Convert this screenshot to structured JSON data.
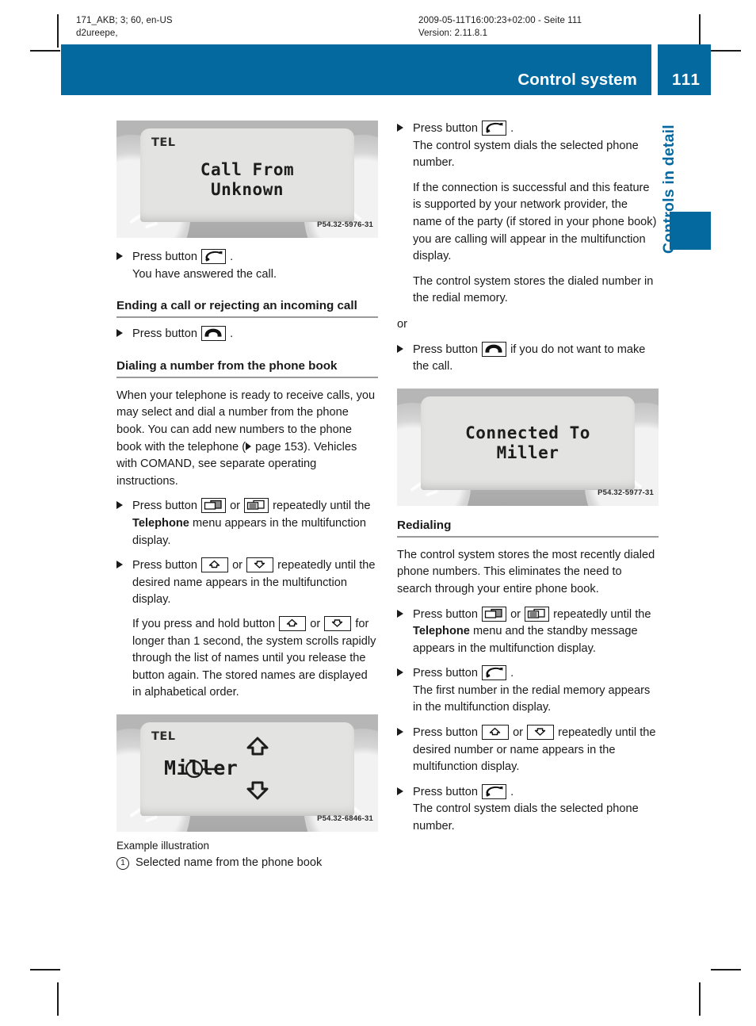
{
  "meta": {
    "left_line1": "171_AKB; 3; 60, en-US",
    "left_line2": "d2ureepe,",
    "right_line1": "2009-05-11T16:00:23+02:00 - Seite 111",
    "right_line2": "Version: 2.11.8.1"
  },
  "header": {
    "title": "Control system",
    "page_number": "111",
    "accent_color": "#04699f"
  },
  "thumb_tab": {
    "label": "Controls in detail"
  },
  "figures": {
    "call_from_unknown": {
      "lcd_label": "TEL",
      "line1": "Call From",
      "line2": "Unknown",
      "code": "P54.32-5976-31"
    },
    "miller_phonebook": {
      "lcd_label": "TEL",
      "name": "Miller",
      "code": "P54.32-6846-31",
      "caption": "Example illustration",
      "legend_number": "1",
      "legend_text": "Selected name from the phone book"
    },
    "connected_to": {
      "line1": "Connected To",
      "line2": "Miller",
      "code": "P54.32-5977-31"
    }
  },
  "left_column": {
    "step_answer": {
      "press": "Press button",
      "icon": "phone-accept-icon",
      "after": ".",
      "sub": "You have answered the call."
    },
    "heading_ending_call": "Ending a call or rejecting an incoming call",
    "step_end": {
      "press": "Press button",
      "icon": "phone-end-icon",
      "after": "."
    },
    "heading_dialing": "Dialing a number from the phone book",
    "intro_part1": "When your telephone is ready to receive calls, you may select and dial a number from the phone book. You can add new numbers to the phone book with the telephone (",
    "intro_page_ref": " page 153). Vehicles with COMAND, see separate operating instructions.",
    "step_menu": {
      "press": "Press button",
      "or": "or",
      "tail": "repeatedly until the",
      "bold": "Telephone",
      "tail2": "menu appears in the multifunction display."
    },
    "step_name": {
      "press": "Press button",
      "or": "or",
      "tail": "repeatedly until the desired name appears in the multifunction display."
    },
    "note_hold": {
      "part1": "If you press and hold button",
      "or": "or",
      "part2": "for longer than 1 second, the system scrolls rapidly through the list of names until you release the button again.",
      "part3": "The stored names are displayed in alphabetical order."
    }
  },
  "right_column": {
    "step_dial": {
      "press": "Press button",
      "after": ".",
      "sub1": "The control system dials the selected phone number.",
      "sub2": "If the connection is successful and this feature is supported by your network provider, the name of the party (if stored in your phone book) you are calling will appear in the multifunction display.",
      "sub3": "The control system stores the dialed number in the redial memory."
    },
    "or_label": "or",
    "step_cancel": {
      "press": "Press button",
      "tail": "if you do not want to make the call."
    },
    "heading_redialing": "Redialing",
    "redial_intro": "The control system stores the most recently dialed phone numbers. This eliminates the need to search through your entire phone book.",
    "step_redial_menu": {
      "press": "Press button",
      "or": "or",
      "tail": "repeatedly until the",
      "bold": "Telephone",
      "tail2": "menu and the standby message appears in the multifunction display."
    },
    "step_redial_call": {
      "press": "Press button",
      "after": ".",
      "sub": "The first number in the redial memory appears in the multifunction display."
    },
    "step_redial_scroll": {
      "press": "Press button",
      "or": "or",
      "tail": "repeatedly until the desired number or name appears in the multifunction display."
    },
    "step_redial_dial": {
      "press": "Press button",
      "after": ".",
      "sub": "The control system dials the selected phone number."
    }
  }
}
